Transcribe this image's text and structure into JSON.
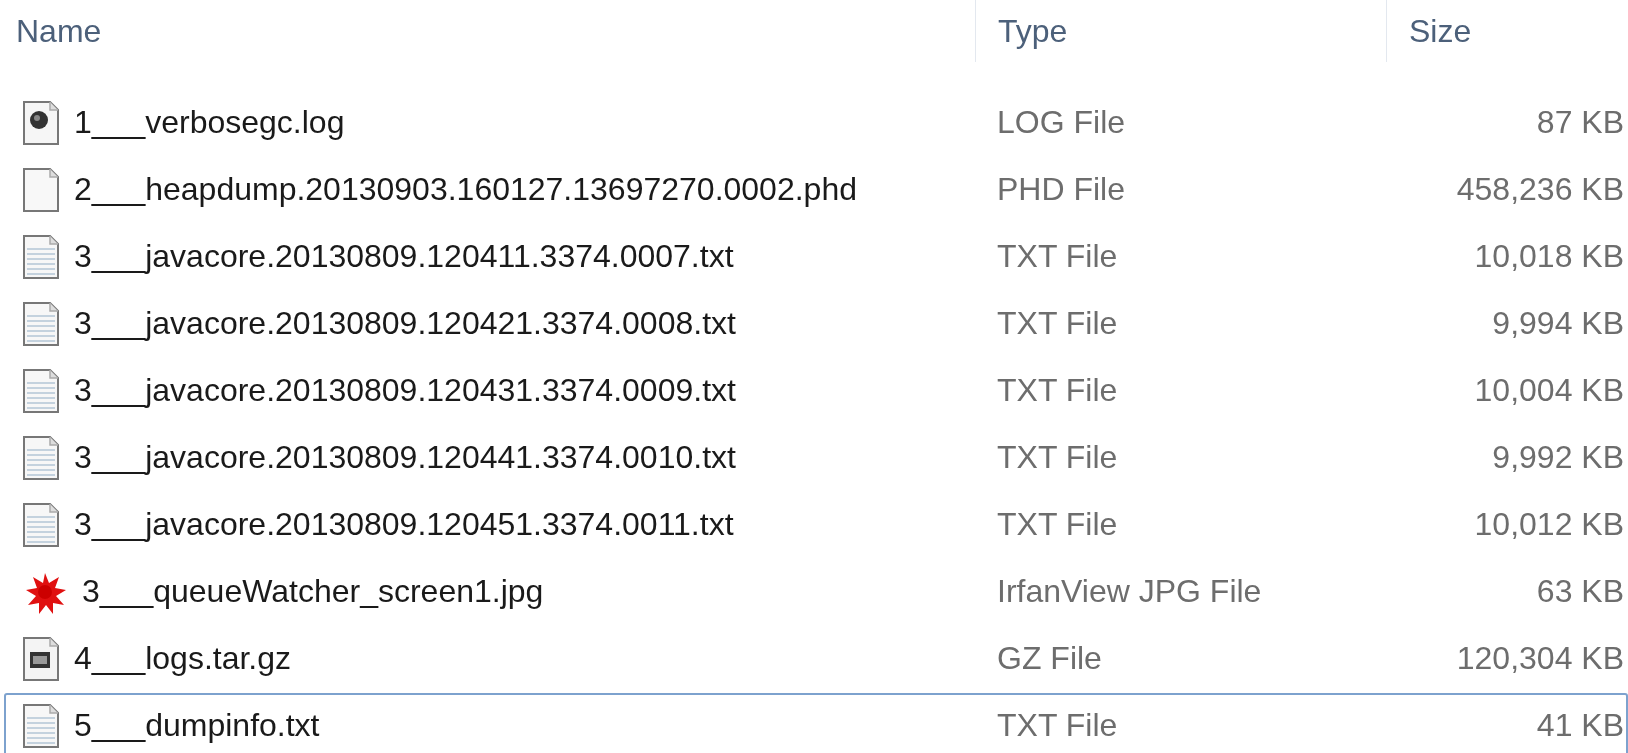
{
  "table": {
    "columns": [
      "Name",
      "Type",
      "Size"
    ],
    "rows": [
      {
        "kind": "log",
        "name": "1___verbosegc.log",
        "type": "LOG File",
        "size": "87 KB",
        "focused": false
      },
      {
        "kind": "blank",
        "name": "2___heapdump.20130903.160127.13697270.0002.phd",
        "type": "PHD File",
        "size": "458,236 KB",
        "focused": false
      },
      {
        "kind": "text",
        "name": "3___javacore.20130809.120411.3374.0007.txt",
        "type": "TXT File",
        "size": "10,018 KB",
        "focused": false
      },
      {
        "kind": "text",
        "name": "3___javacore.20130809.120421.3374.0008.txt",
        "type": "TXT File",
        "size": "9,994 KB",
        "focused": false
      },
      {
        "kind": "text",
        "name": "3___javacore.20130809.120431.3374.0009.txt",
        "type": "TXT File",
        "size": "10,004 KB",
        "focused": false
      },
      {
        "kind": "text",
        "name": "3___javacore.20130809.120441.3374.0010.txt",
        "type": "TXT File",
        "size": "9,992 KB",
        "focused": false
      },
      {
        "kind": "text",
        "name": "3___javacore.20130809.120451.3374.0011.txt",
        "type": "TXT File",
        "size": "10,012 KB",
        "focused": false
      },
      {
        "kind": "image",
        "name": "3___queueWatcher_screen1.jpg",
        "type": "IrfanView JPG File",
        "size": "63 KB",
        "focused": false
      },
      {
        "kind": "archive",
        "name": "4___logs.tar.gz",
        "type": "GZ File",
        "size": "120,304 KB",
        "focused": false
      },
      {
        "kind": "text",
        "name": "5___dumpinfo.txt",
        "type": "TXT File",
        "size": "41 KB",
        "focused": true
      }
    ]
  }
}
